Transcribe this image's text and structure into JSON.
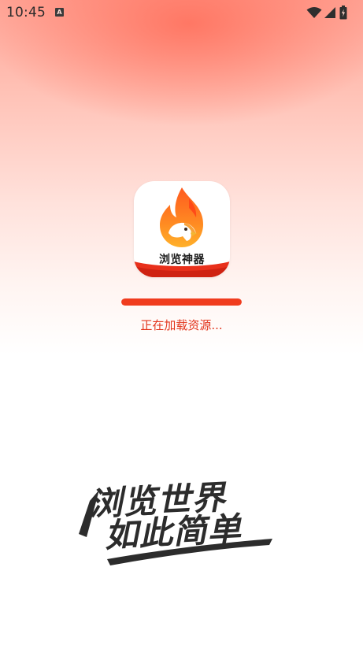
{
  "status_bar": {
    "time": "10:45",
    "notification_icon": "text-a-notification-icon",
    "icons": [
      "wifi-icon",
      "signal-icon",
      "battery-icon"
    ]
  },
  "app": {
    "icon_text": "浏览神器",
    "icon_name": "flame-eagle-logo"
  },
  "loading": {
    "progress": 1.0,
    "text": "正在加载资源..."
  },
  "slogan": {
    "line1": "浏览世界",
    "line2": "如此简单"
  },
  "colors": {
    "accent": "#f03c1e",
    "top_gradient": "#ff8a78",
    "slogan": "#2c2c2c"
  }
}
